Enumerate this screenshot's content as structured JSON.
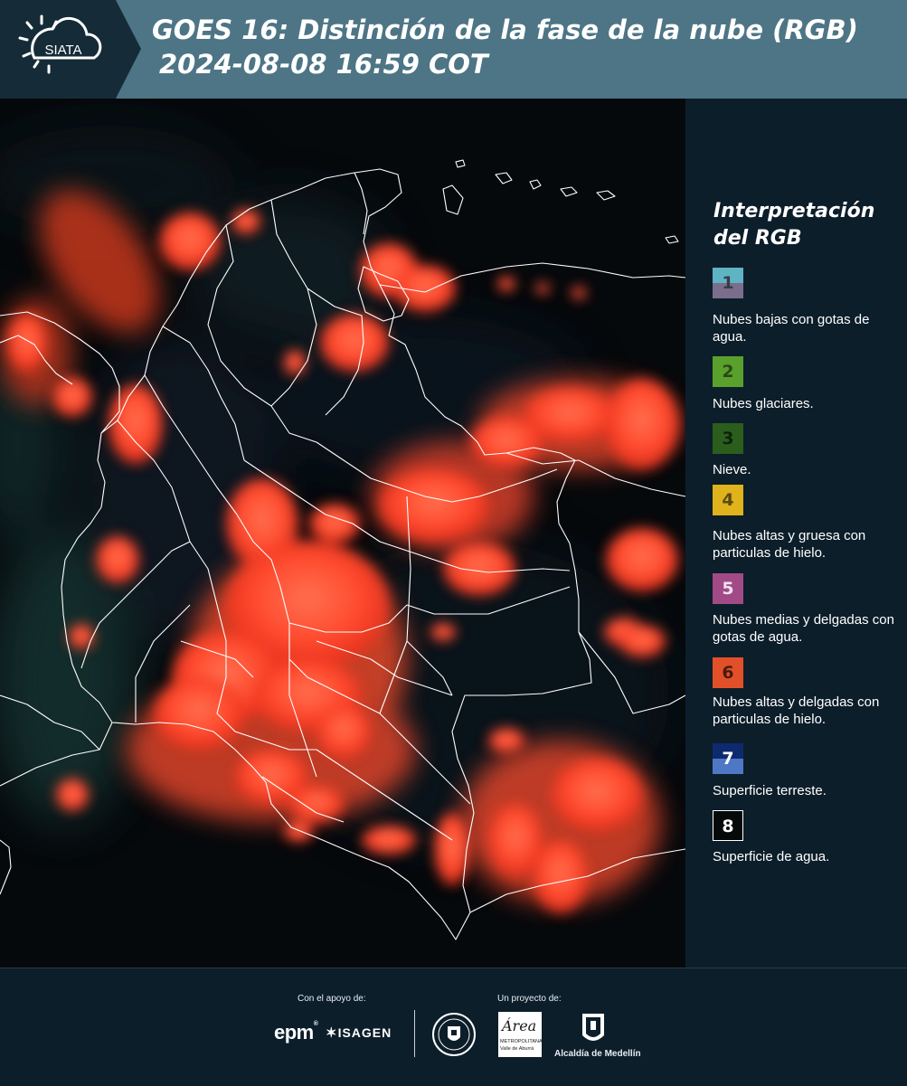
{
  "header": {
    "logo_text": "SIATA",
    "title_line1": "GOES 16: Distinción de la fase de la nube (RGB)",
    "title_line2": "2024-08-08 16:59 COT"
  },
  "legend": {
    "title_line1": "Interpretación",
    "title_line2": "del RGB",
    "items": [
      {
        "num": "1",
        "label": "Nubes bajas con gotas de agua.",
        "color_top": "#5fb4c4",
        "color_bottom": "#7a6e8c",
        "text_color": "#3a3a46"
      },
      {
        "num": "2",
        "label": "Nubes glaciares.",
        "color_top": "#5aa02c",
        "color_bottom": "#5aa02c",
        "text_color": "#2a4a16"
      },
      {
        "num": "3",
        "label": "Nieve.",
        "color_top": "#2b5e1c",
        "color_bottom": "#2b5e1c",
        "text_color": "#0e220a"
      },
      {
        "num": "4",
        "label": "Nubes altas y gruesa con particulas de hielo.",
        "color_top": "#e0b21c",
        "color_bottom": "#e0b21c",
        "text_color": "#5a4a10"
      },
      {
        "num": "5",
        "label": "Nubes medias y delgadas con gotas de agua.",
        "color_top": "#a14a86",
        "color_bottom": "#a14a86",
        "text_color": "#f0e0ee"
      },
      {
        "num": "6",
        "label": "Nubes altas y delgadas con particulas de hielo.",
        "color_top": "#e2502a",
        "color_bottom": "#e2502a",
        "text_color": "#4a1a0c"
      },
      {
        "num": "7",
        "label": "Superficie terreste.",
        "color_top": "#0e2a6e",
        "color_bottom": "#4e78c6",
        "text_color": "#ffffff"
      },
      {
        "num": "8",
        "label": "Superficie de agua.",
        "color_top": "#050a08",
        "color_bottom": "#050a08",
        "text_color": "#ffffff"
      }
    ]
  },
  "footer": {
    "support_label": "Con el apoyo de:",
    "project_label": "Un proyecto de:",
    "epm_logo_text": "epm",
    "isagen_logo_text": "ISAGEN",
    "area_logo_text": "Área",
    "area_sub_text_1": "METROPOLITANA",
    "area_sub_text_2": "Valle de Aburrá",
    "alcaldia_logo_text": "Alcaldía de Medellín"
  },
  "colors": {
    "header_bg": "#4d7585",
    "page_bg": "#0c1e2a",
    "cloud_red": "#ff4a2e"
  }
}
